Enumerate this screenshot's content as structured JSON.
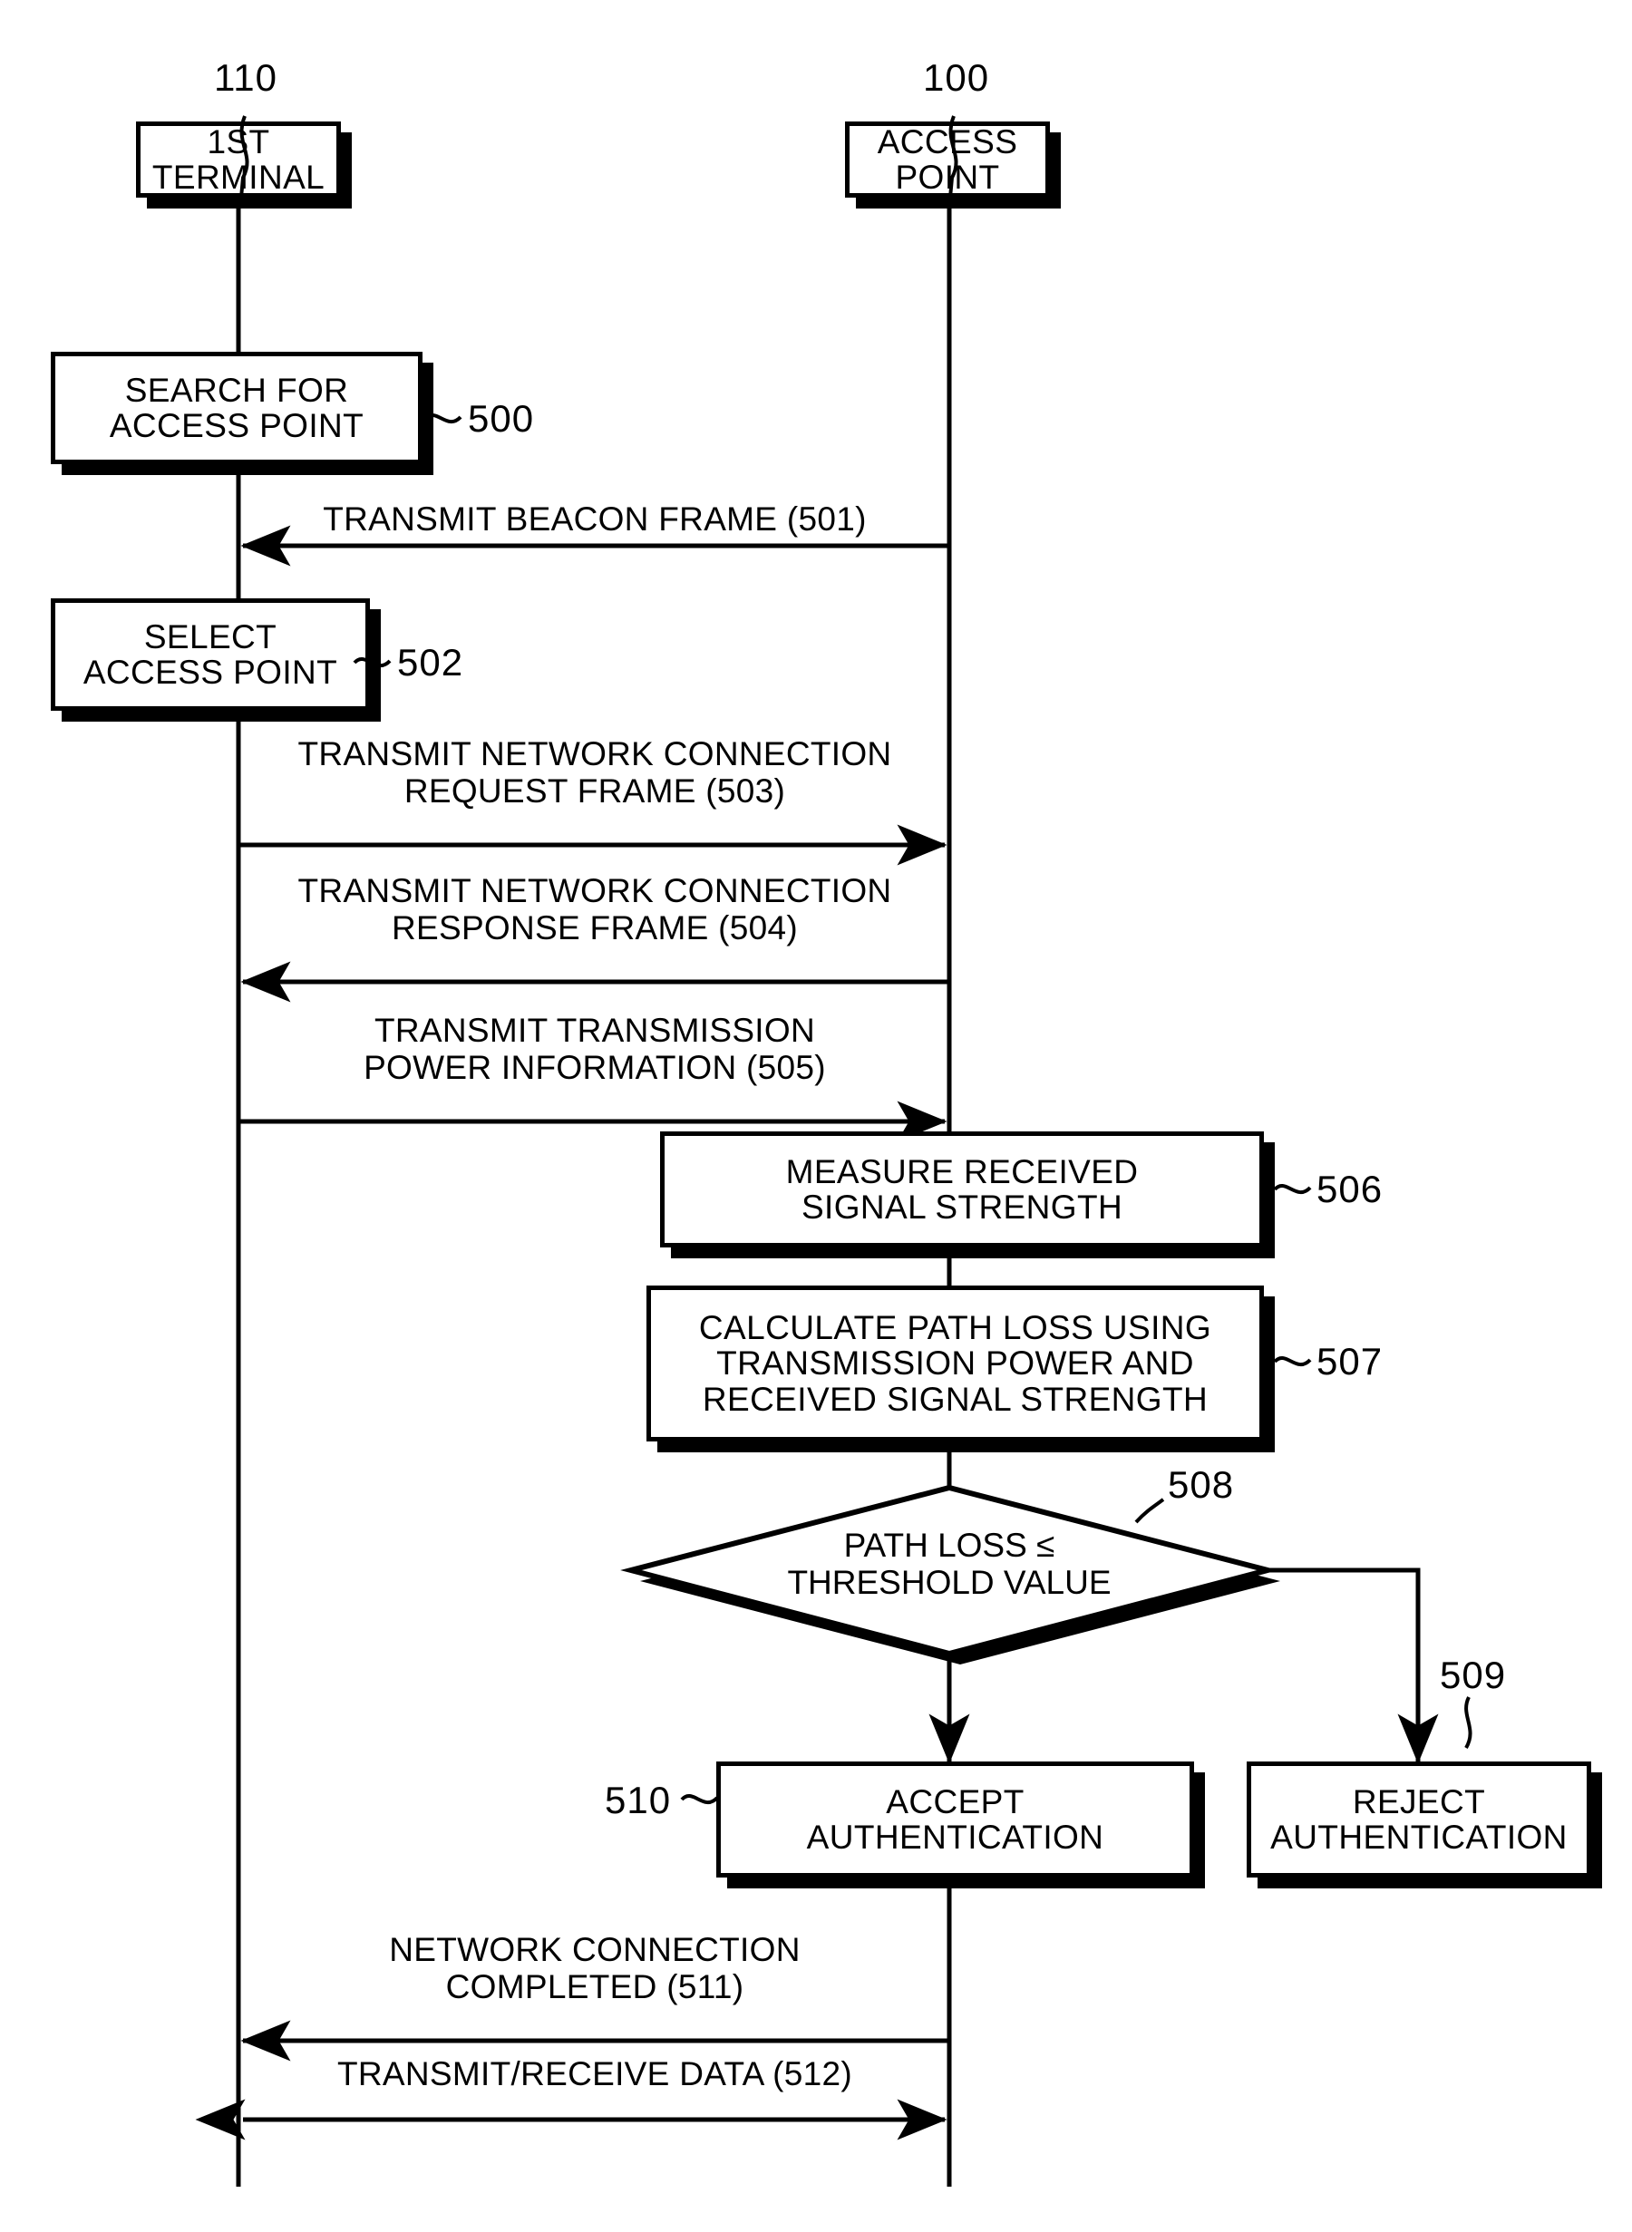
{
  "figure": {
    "type": "patent-sequence-flow-diagram",
    "actors": [
      {
        "ref": "110",
        "label": "1ST\nTERMINAL"
      },
      {
        "ref": "100",
        "label": "ACCESS\nPOINT"
      }
    ],
    "terminal_steps": [
      {
        "ref": "500",
        "label": "SEARCH FOR\nACCESS POINT"
      },
      {
        "ref": "502",
        "label": "SELECT\nACCESS POINT"
      }
    ],
    "access_point_steps": [
      {
        "ref": "506",
        "label": "MEASURE RECEIVED\nSIGNAL STRENGTH"
      },
      {
        "ref": "507",
        "label": "CALCULATE PATH LOSS USING\nTRANSMISSION POWER AND\nRECEIVED SIGNAL STRENGTH"
      }
    ],
    "decision": {
      "ref": "508",
      "label": "PATH LOSS ≤\nTHRESHOLD VALUE"
    },
    "outcomes": [
      {
        "ref": "510",
        "label": "ACCEPT\nAUTHENTICATION"
      },
      {
        "ref": "509",
        "label": "REJECT\nAUTHENTICATION"
      }
    ],
    "messages": [
      {
        "ref": "501",
        "label": "TRANSMIT BEACON FRAME (501)",
        "direction": "ap-to-terminal"
      },
      {
        "ref": "503",
        "label": "TRANSMIT NETWORK CONNECTION\nREQUEST FRAME (503)",
        "direction": "terminal-to-ap"
      },
      {
        "ref": "504",
        "label": "TRANSMIT NETWORK CONNECTION\nRESPONSE FRAME (504)",
        "direction": "ap-to-terminal"
      },
      {
        "ref": "505",
        "label": "TRANSMIT TRANSMISSION\nPOWER INFORMATION (505)",
        "direction": "terminal-to-ap"
      },
      {
        "ref": "511",
        "label": "NETWORK CONNECTION\nCOMPLETED (511)",
        "direction": "ap-to-terminal"
      },
      {
        "ref": "512",
        "label": "TRANSMIT/RECEIVE DATA (512)",
        "direction": "bidirectional"
      }
    ],
    "refs": {
      "r110": "110",
      "r100": "100",
      "r500": "500",
      "r502": "502",
      "r506": "506",
      "r507": "507",
      "r508": "508",
      "r509": "509",
      "r510": "510"
    },
    "colors": {
      "ink": "#000000",
      "paper": "#ffffff"
    }
  }
}
